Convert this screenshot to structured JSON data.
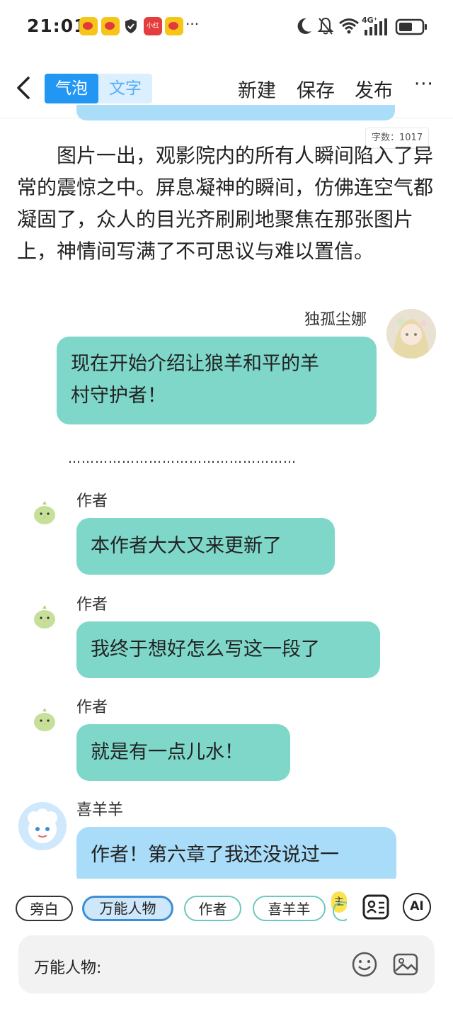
{
  "status_bar": {
    "time": "21:01",
    "app_badge_text": "小红书",
    "more": "···",
    "network": "4G⁺"
  },
  "header": {
    "back_icon": "chevron-left-icon",
    "mode_bubble": "气泡",
    "mode_text": "文字",
    "new_label": "新建",
    "save_label": "保存",
    "publish_label": "发布",
    "more_label": "···"
  },
  "word_count": "字数：1017",
  "narration": "图片一出，观影院内的所有人瞬间陷入了异常的震惊之中。屏息凝神的瞬间，仿佛连空气都凝固了，众人的目光齐刷刷地聚焦在那张图片上，神情间写满了不可思议与难以置信。",
  "messages": [
    {
      "name": "独孤尘娜",
      "lines": [
        "现在开始介绍让狼羊和平的羊",
        "村守护者！"
      ]
    },
    {
      "separator": "……………………………………………"
    },
    {
      "name": "作者",
      "text": "本作者大大又来更新了"
    },
    {
      "name": "作者",
      "text": "我终于想好怎么写这一段了"
    },
    {
      "name": "作者",
      "text": "就是有一点儿水！"
    },
    {
      "name": "喜羊羊",
      "text": "作者！第六章了我还没说过一"
    }
  ],
  "chips": [
    "旁白",
    "万能人物",
    "作者",
    "喜羊羊",
    "主"
  ],
  "input": {
    "label": "万能人物:"
  },
  "colors": {
    "accent": "#2196f3",
    "teal_bubble": "#7ed7c9",
    "blue_bubble": "#a9dcf8"
  }
}
